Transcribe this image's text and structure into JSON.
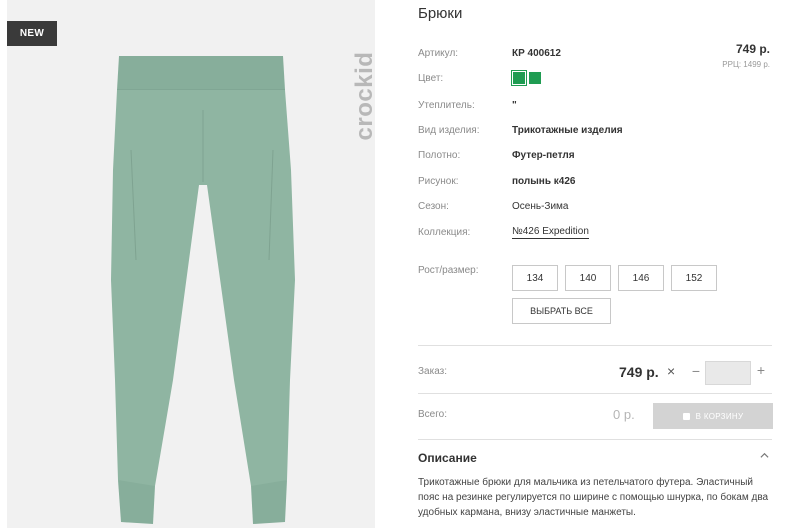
{
  "product": {
    "badge": "NEW",
    "brand": "crockid",
    "title": "Брюки",
    "price": "749 р.",
    "rrp": "РРЦ: 1499 р."
  },
  "attributes": [
    {
      "label": "Артикул:",
      "value": "КР 400612"
    },
    {
      "label": "Цвет:",
      "value": ""
    },
    {
      "label": "Утеплитель:",
      "value": "\""
    },
    {
      "label": "Вид изделия:",
      "value": "Трикотажные изделия"
    },
    {
      "label": "Полотно:",
      "value": "Футер-петля"
    },
    {
      "label": "Рисунок:",
      "value": "полынь к426"
    },
    {
      "label": "Сезон:",
      "value": "Осень-Зима"
    },
    {
      "label": "Коллекция:",
      "value": "№426 Expedition"
    }
  ],
  "colors": {
    "swatch": "#1f9c52",
    "pants": "#8fb5a2",
    "cart_button": "#d3d3d3"
  },
  "sizes": {
    "label": "Рост/размер:",
    "options": [
      "134",
      "140",
      "146",
      "152"
    ],
    "select_all": "ВЫБРАТЬ ВСЕ"
  },
  "order": {
    "label": "Заказ:",
    "price": "749 р.",
    "times": "×",
    "minus": "−",
    "plus": "+",
    "quantity": ""
  },
  "total": {
    "label": "Всего:",
    "value": "0 р.",
    "cart_button": "В КОРЗИНУ"
  },
  "description": {
    "title": "Описание",
    "text": "Трикотажные брюки для мальчика из петельчатого футера. Эластичный пояс на резинке регулируется по ширине с помощью шнурка, по бокам два удобных кармана, внизу эластичные манжеты."
  }
}
